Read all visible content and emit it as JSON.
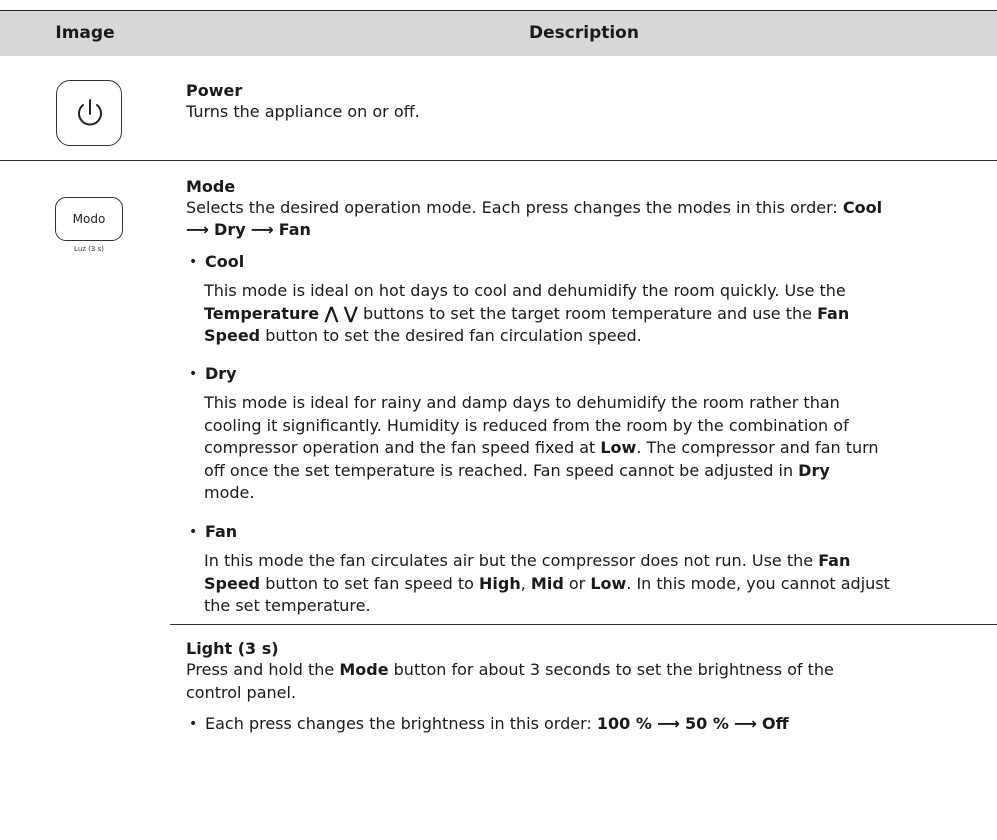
{
  "header": {
    "image_label": "Image",
    "description_label": "Description"
  },
  "power": {
    "title": "Power",
    "text": "Turns the appliance on or off."
  },
  "mode": {
    "button_label": "Modo",
    "button_sub": "Luz (3 s)",
    "title": "Mode",
    "intro_pre": "Selects the desired operation mode. Each press changes the modes in this order: ",
    "order_1": "Cool",
    "arrow": "⟶",
    "order_2": "Dry",
    "order_3": "Fan",
    "bullets": [
      {
        "head": "Cool"
      },
      {
        "head": "Dry"
      },
      {
        "head": "Fan"
      }
    ],
    "cool": {
      "p1": "This mode is ideal on hot days to cool and dehumidify the room quickly. Use the",
      "temp": "Temperature",
      "up": "⋀",
      "down": "⋁",
      "p2": " buttons to set the target room temperature and use the ",
      "fan": "Fan",
      "speed": "Speed",
      "p3": " button to set the desired fan circulation speed."
    },
    "dry": {
      "l1": "This mode is ideal for rainy and damp days to dehumidify the room rather than",
      "l2": "cooling it significantly. Humidity is reduced from the room by the combination of",
      "l3_pre": "compressor operation and the fan speed fixed at ",
      "low": "Low",
      "l3_post": ". The compressor and fan turn",
      "l4_pre": "off once the set temperature is reached. Fan speed cannot be adjusted in ",
      "dry": "Dry",
      "l5": "mode."
    },
    "fan": {
      "l1_pre": "In this mode the fan circulates air but the compressor does not run. Use the ",
      "fan": "Fan",
      "speed": "Speed",
      "l2_mid": " button to set fan speed to ",
      "high": "High",
      "sep": ", ",
      "mid": "Mid",
      "or": " or ",
      "low": "Low",
      "l2_post": ". In this mode, you cannot adjust",
      "l3": "the set temperature."
    }
  },
  "light": {
    "title": "Light (3 s)",
    "l1_pre": "Press and hold the ",
    "mode": "Mode",
    "l1_post": " button for about 3 seconds to set the brightness of the",
    "l2": "control panel.",
    "bullet_pre": "Each press changes the brightness in this order: ",
    "b1": "100 %",
    "arrow": "⟶",
    "b2": "50 %",
    "b3": "Off"
  }
}
